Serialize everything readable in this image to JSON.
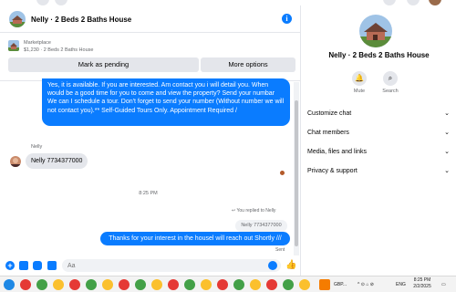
{
  "conversation": {
    "title": "Nelly · 2 Beds 2 Baths House"
  },
  "listing": {
    "source": "Marketplace",
    "description": "$1,230 · 2 Beds 2 Baths House",
    "mark_pending_label": "Mark as pending",
    "more_options_label": "More options"
  },
  "messages": {
    "first_outgoing": "Yes, it is available. If you are interested.  Am contact you i will detail you.  When would be a good time for you to come and view the property? Send your numbar We can I schedule a tour.  Don't forget to send your number (Without number we will not contact you).** Self-Guided Tours Only. Appointment Required /",
    "sender_name": "Nelly",
    "incoming": "Nelly 7734377000",
    "timestamp": "8:25 PM",
    "reply_label": "You replied to Nelly",
    "reply_quote": "Nelly 7734377000",
    "second_outgoing": "Thanks for your interest in the housel will reach out Shortly ///",
    "status": "Sent"
  },
  "composer": {
    "placeholder": "Aa"
  },
  "info_panel": {
    "name": "Nelly · 2 Beds 2 Baths House",
    "mute_label": "Mute",
    "search_label": "Search",
    "sections": [
      "Customize chat",
      "Chat members",
      "Media, files and links",
      "Privacy & support"
    ]
  },
  "taskbar": {
    "weather": "GBP...",
    "language": "ENG",
    "time": "8:25 PM",
    "date": "2/2/2025"
  },
  "colors": {
    "accent_blue": "#0a7cff",
    "bubble_grey": "#e4e6eb",
    "secondary_text": "#65676b"
  },
  "icons": [
    "info-icon",
    "mute-bell-icon",
    "search-icon",
    "chevron-down-icon",
    "plus-icon",
    "image-icon",
    "sticker-icon",
    "gif-icon",
    "emoji-icon",
    "like-icon",
    "reply-arrow-icon"
  ]
}
